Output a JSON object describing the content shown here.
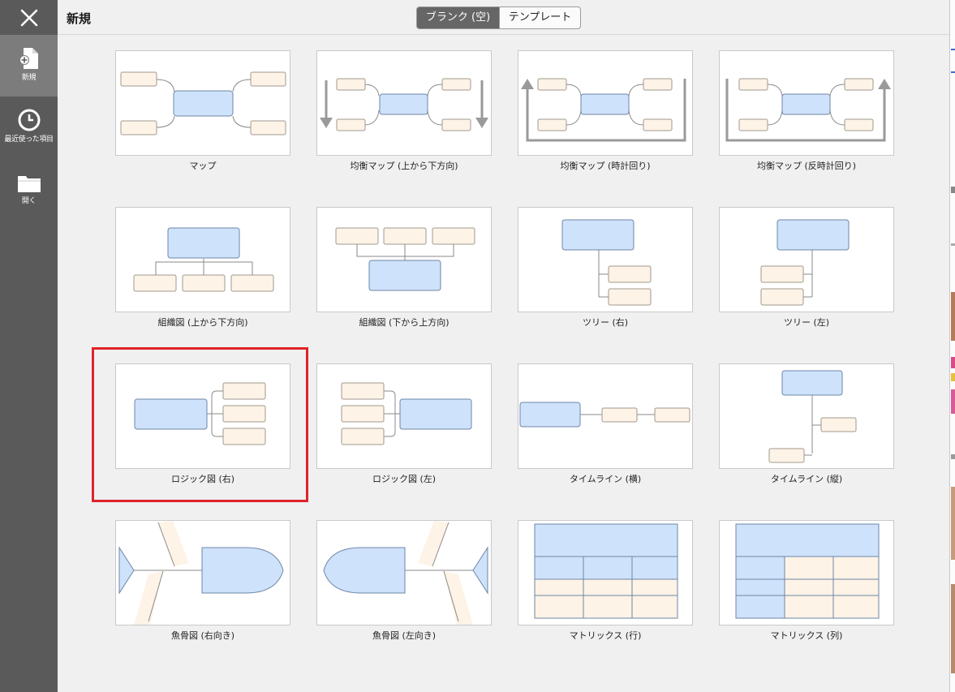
{
  "header": {
    "title": "新規"
  },
  "mode_toggle": {
    "blank_label": "ブランク (空)",
    "template_label": "テンプレート"
  },
  "sidebar": {
    "items": [
      {
        "id": "new",
        "label": "新規",
        "icon": "new-document-icon"
      },
      {
        "id": "recent",
        "label": "最近使った項目",
        "icon": "clock-icon"
      },
      {
        "id": "open",
        "label": "開く",
        "icon": "folder-icon"
      }
    ]
  },
  "colors": {
    "node_fill": "#cfe2fb",
    "node_stroke": "#6d86a7",
    "leaf_fill": "#fdf3e6",
    "leaf_stroke": "#a09a8f",
    "line": "#8a8a8a",
    "highlight": "#e0232a"
  },
  "templates": [
    {
      "name": "map",
      "caption": "マップ"
    },
    {
      "name": "balanced-map-top-down",
      "caption": "均衡マップ (上から下方向)"
    },
    {
      "name": "balanced-map-clockwise",
      "caption": "均衡マップ (時計回り)"
    },
    {
      "name": "balanced-map-counterclockwise",
      "caption": "均衡マップ (反時計回り)"
    },
    {
      "name": "org-chart-top-down",
      "caption": "組織図 (上から下方向)"
    },
    {
      "name": "org-chart-bottom-up",
      "caption": "組織図 (下から上方向)"
    },
    {
      "name": "tree-right",
      "caption": "ツリー (右)"
    },
    {
      "name": "tree-left",
      "caption": "ツリー (左)"
    },
    {
      "name": "logic-chart-right",
      "caption": "ロジック図 (右)"
    },
    {
      "name": "logic-chart-left",
      "caption": "ロジック図 (左)"
    },
    {
      "name": "timeline-horizontal",
      "caption": "タイムライン (横)"
    },
    {
      "name": "timeline-vertical",
      "caption": "タイムライン (縦)"
    },
    {
      "name": "fishbone-right",
      "caption": "魚骨図 (右向き)"
    },
    {
      "name": "fishbone-left",
      "caption": "魚骨図 (左向き)"
    },
    {
      "name": "matrix-rows",
      "caption": "マトリックス (行)"
    },
    {
      "name": "matrix-columns",
      "caption": "マトリックス (列)"
    }
  ],
  "selected_template": "logic-chart-right"
}
